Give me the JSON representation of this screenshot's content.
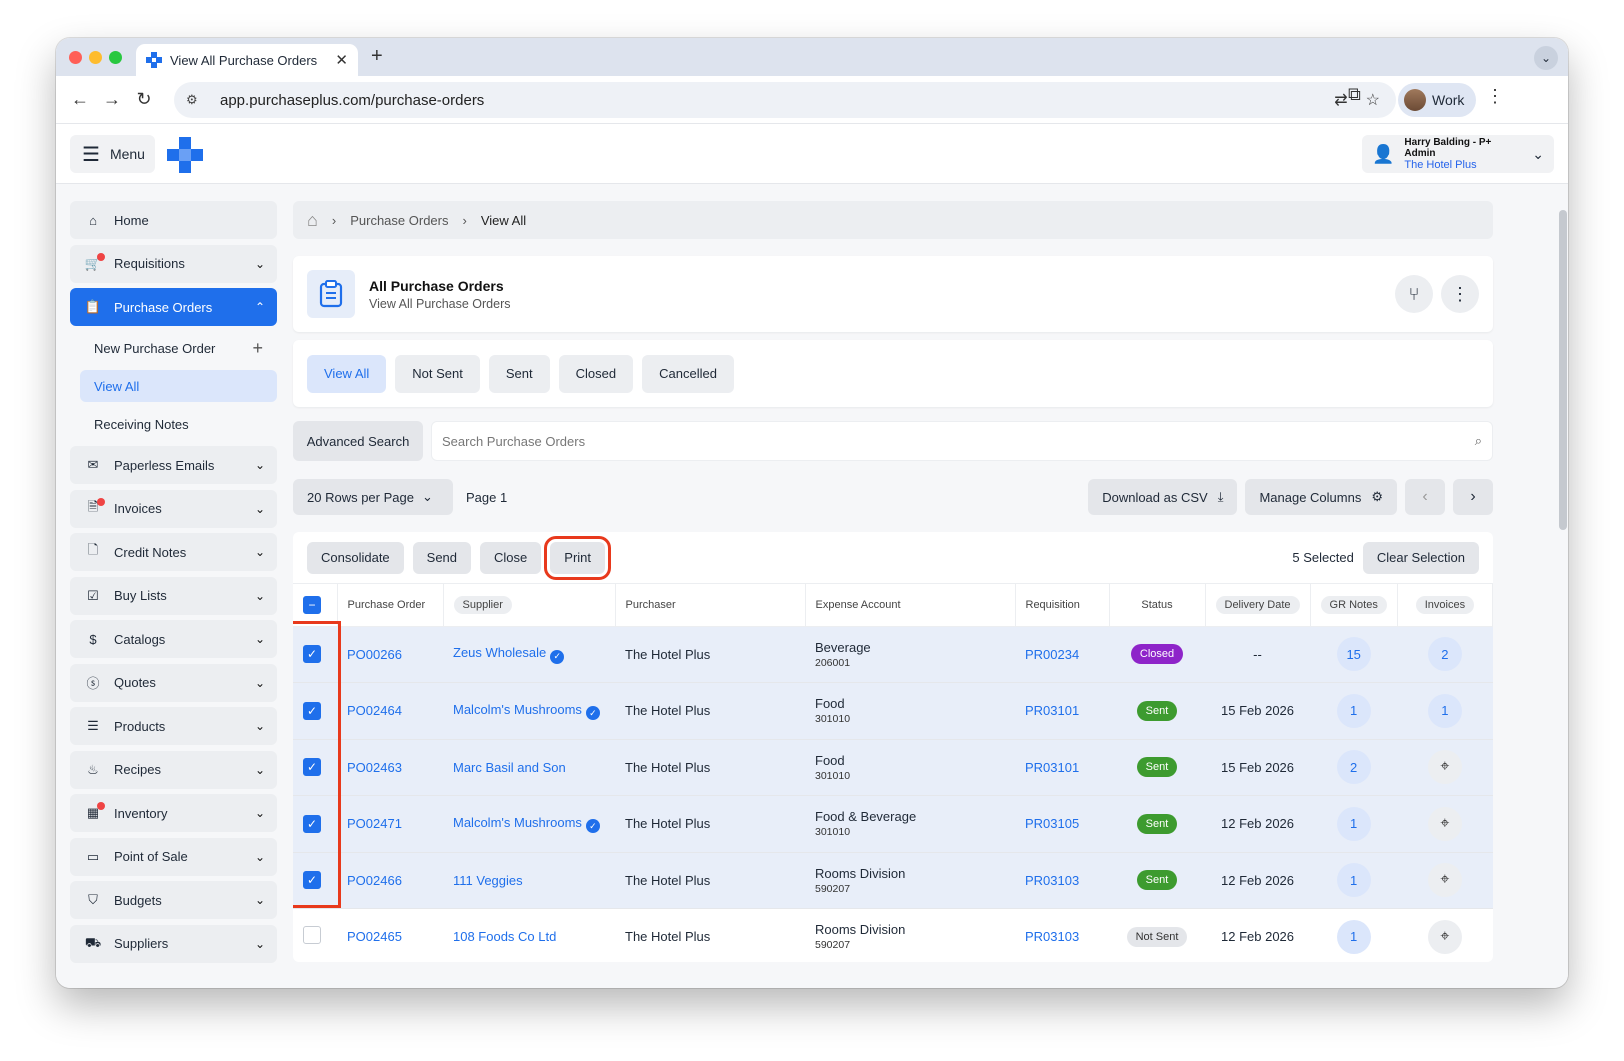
{
  "browser": {
    "tab_title": "View All Purchase Orders",
    "url": "app.purchaseplus.com/purchase-orders",
    "profile_label": "Work"
  },
  "header": {
    "menu_label": "Menu",
    "user_name": "Harry Balding - P+ Admin",
    "user_org": "The Hotel Plus"
  },
  "sidebar": {
    "items": [
      {
        "label": "Home",
        "icon": "home-icon"
      },
      {
        "label": "Requisitions",
        "icon": "cart-icon"
      },
      {
        "label": "Purchase Orders",
        "icon": "clipboard-icon"
      },
      {
        "label": "Paperless Emails",
        "icon": "envelope-icon"
      },
      {
        "label": "Invoices",
        "icon": "invoice-icon"
      },
      {
        "label": "Credit Notes",
        "icon": "credit-note-icon"
      },
      {
        "label": "Buy Lists",
        "icon": "buy-list-icon"
      },
      {
        "label": "Catalogs",
        "icon": "catalog-icon"
      },
      {
        "label": "Quotes",
        "icon": "dollar-circle-icon"
      },
      {
        "label": "Products",
        "icon": "products-icon"
      },
      {
        "label": "Recipes",
        "icon": "recipe-icon"
      },
      {
        "label": "Inventory",
        "icon": "inventory-icon"
      },
      {
        "label": "Point of Sale",
        "icon": "pos-icon"
      },
      {
        "label": "Budgets",
        "icon": "shield-dollar-icon"
      },
      {
        "label": "Suppliers",
        "icon": "truck-icon"
      }
    ],
    "sub_items": {
      "new_po": "New Purchase Order",
      "view_all": "View All",
      "receiving_notes": "Receiving Notes"
    }
  },
  "breadcrumb": {
    "level1": "Purchase Orders",
    "level2": "View All"
  },
  "page": {
    "title": "All Purchase Orders",
    "subtitle": "View All Purchase Orders"
  },
  "filters": [
    "View All",
    "Not Sent",
    "Sent",
    "Closed",
    "Cancelled"
  ],
  "search": {
    "advanced_label": "Advanced Search",
    "placeholder": "Search Purchase Orders"
  },
  "pager": {
    "rows_per_page": "20 Rows per Page",
    "page_label": "Page 1",
    "download_label": "Download as CSV",
    "manage_columns_label": "Manage Columns"
  },
  "actions": {
    "consolidate": "Consolidate",
    "send": "Send",
    "close": "Close",
    "print": "Print",
    "selected_count": "5 Selected",
    "clear_selection": "Clear Selection"
  },
  "table": {
    "headers": {
      "po": "Purchase Order",
      "supplier": "Supplier",
      "purchaser": "Purchaser",
      "expense": "Expense Account",
      "requisition": "Requisition",
      "status": "Status",
      "delivery": "Delivery Date",
      "gr_notes": "GR Notes",
      "invoices": "Invoices"
    },
    "rows": [
      {
        "po": "PO00266",
        "supplier": "Zeus Wholesale",
        "purchaser": "The Hotel Plus",
        "account": "Beverage",
        "account_code": "206001",
        "requisition": "PR00234",
        "status": "Closed",
        "delivery": "--",
        "gr": "15",
        "inv": "2"
      },
      {
        "po": "PO02464",
        "supplier": "Malcolm's Mushrooms",
        "purchaser": "The Hotel Plus",
        "account": "Food",
        "account_code": "301010",
        "requisition": "PR03101",
        "status": "Sent",
        "delivery": "15 Feb 2026",
        "gr": "1",
        "inv": "1"
      },
      {
        "po": "PO02463",
        "supplier": "Marc Basil and Son",
        "purchaser": "The Hotel Plus",
        "account": "Food",
        "account_code": "301010",
        "requisition": "PR03101",
        "status": "Sent",
        "delivery": "15 Feb 2026",
        "gr": "2",
        "inv": ""
      },
      {
        "po": "PO02471",
        "supplier": "Malcolm's Mushrooms",
        "purchaser": "The Hotel Plus",
        "account": "Food & Beverage",
        "account_code": "301010",
        "requisition": "PR03105",
        "status": "Sent",
        "delivery": "12 Feb 2026",
        "gr": "1",
        "inv": ""
      },
      {
        "po": "PO02466",
        "supplier": "111 Veggies",
        "purchaser": "The Hotel Plus",
        "account": "Rooms Division",
        "account_code": "590207",
        "requisition": "PR03103",
        "status": "Sent",
        "delivery": "12 Feb 2026",
        "gr": "1",
        "inv": ""
      },
      {
        "po": "PO02465",
        "supplier": "108 Foods Co Ltd",
        "purchaser": "The Hotel Plus",
        "account": "Rooms Division",
        "account_code": "590207",
        "requisition": "PR03103",
        "status": "Not Sent",
        "delivery": "12 Feb 2026",
        "gr": "1",
        "inv": ""
      }
    ]
  },
  "colors": {
    "accent": "#1f6feb",
    "closed": "#8e24c9",
    "sent": "#3d9b2f",
    "highlight": "#e8391c"
  }
}
